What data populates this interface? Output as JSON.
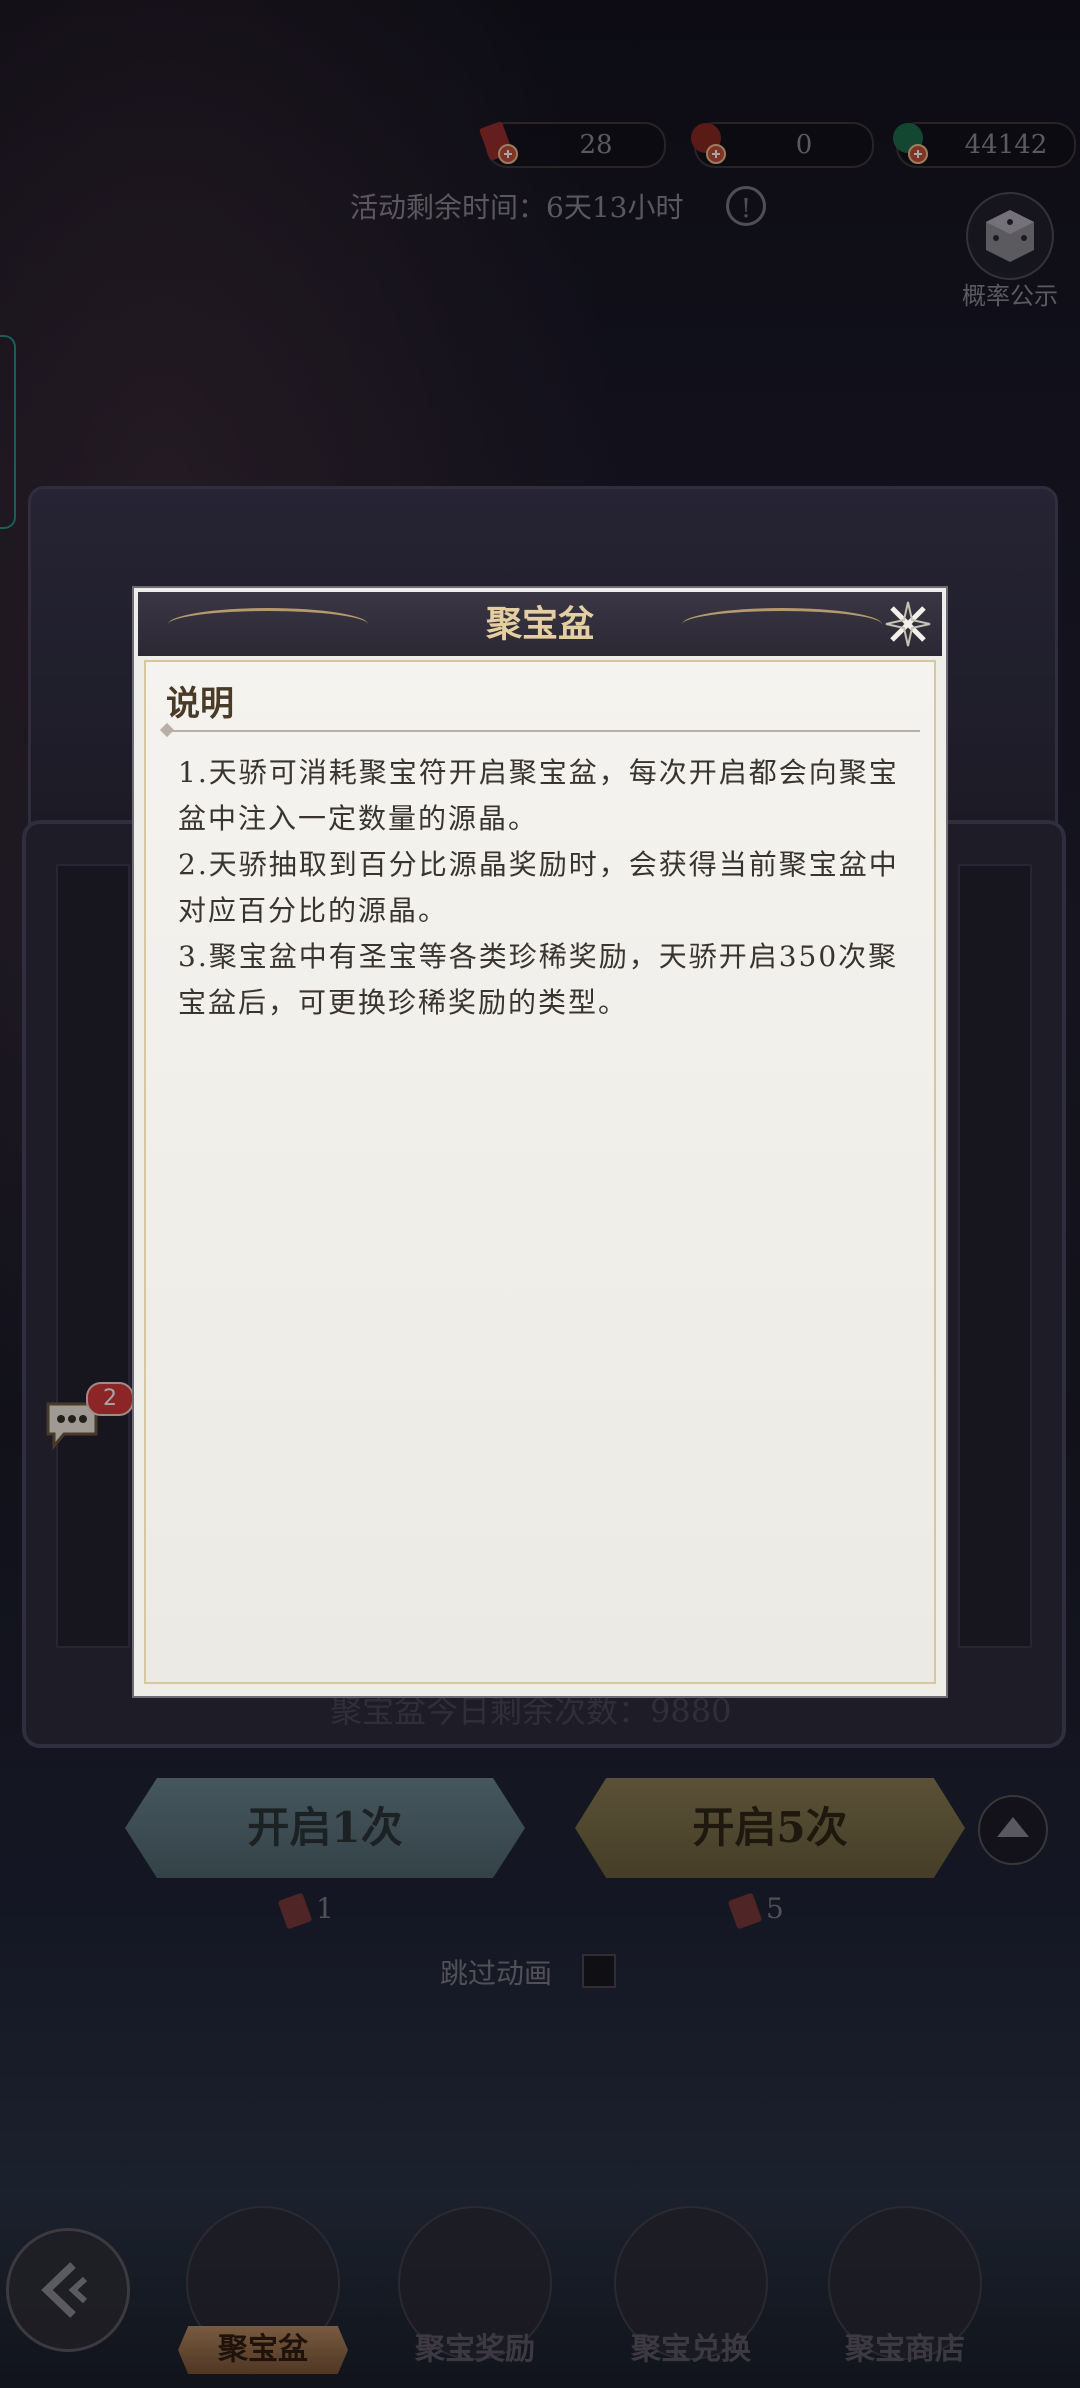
{
  "resources": [
    {
      "icon": "red-talisman-icon",
      "value": "28"
    },
    {
      "icon": "red-token-icon",
      "value": "0"
    },
    {
      "icon": "green-gem-icon",
      "value": "44142"
    }
  ],
  "event": {
    "remaining_time": "活动剩余时间：6天13小时",
    "probability_label": "概率公示"
  },
  "chat": {
    "badge": "2"
  },
  "bowl": {
    "remaining_today": "聚宝盆今日剩余次数：9880"
  },
  "actions": {
    "open_1_label": "开启1次",
    "open_5_label": "开启5次",
    "open_1_cost": "1",
    "open_5_cost": "5",
    "skip_animation_label": "跳过动画"
  },
  "nav": {
    "items": [
      {
        "label": "聚宝盆",
        "active": true
      },
      {
        "label": "聚宝奖励",
        "active": false
      },
      {
        "label": "聚宝兑换",
        "active": false
      },
      {
        "label": "聚宝商店",
        "active": false
      }
    ]
  },
  "dialog": {
    "title": "聚宝盆",
    "section_title": "说明",
    "lines": [
      "1.天骄可消耗聚宝符开启聚宝盆，每次开启都会向聚宝盆中注入一定数量的源晶。",
      "2.天骄抽取到百分比源晶奖励时，会获得当前聚宝盆中对应百分比的源晶。",
      "3.聚宝盆中有圣宝等各类珍稀奖励，天骄开启350次聚宝盆后，可更换珍稀奖励的类型。"
    ]
  },
  "colors": {
    "dialog_title": "#e5cfa0",
    "accent_gold": "#b59a6c",
    "badge_red": "#d83a3a"
  }
}
